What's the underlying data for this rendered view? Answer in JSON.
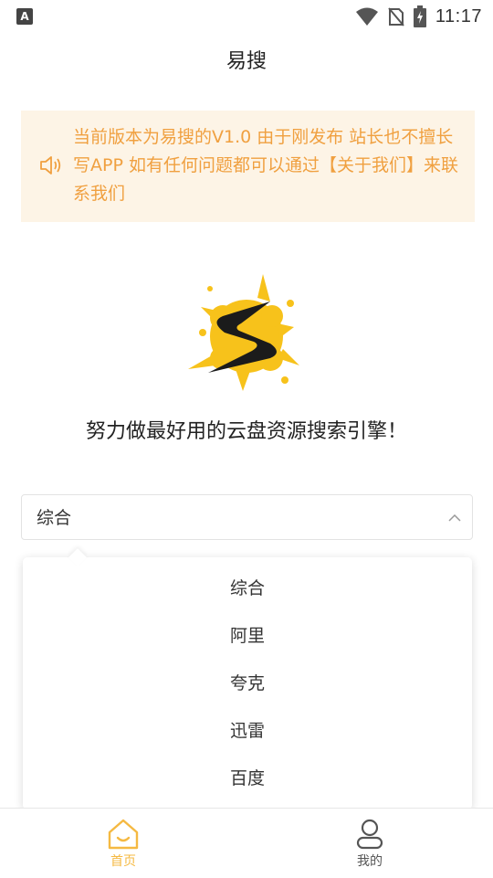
{
  "status_bar": {
    "left_icon_letter": "A",
    "time": "11:17"
  },
  "app_bar": {
    "title": "易搜"
  },
  "notice": {
    "icon": "speaker-icon",
    "text": "当前版本为易搜的V1.0 由于刚发布 站长也不擅长写APP 如有任何问题都可以通过【关于我们】来联系我们"
  },
  "slogan": "努力做最好用的云盘资源搜索引擎！",
  "search_type": {
    "selected": "综合",
    "options": [
      "综合",
      "阿里",
      "夸克",
      "迅雷",
      "百度"
    ]
  },
  "tab_bar": {
    "items": [
      {
        "label": "首页",
        "icon": "home-icon",
        "active": true
      },
      {
        "label": "我的",
        "icon": "user-icon",
        "active": false
      }
    ]
  },
  "colors": {
    "accent": "#f5b942",
    "notice_bg": "#fdf4e6",
    "notice_text": "#f0a040",
    "inactive": "#555555"
  }
}
